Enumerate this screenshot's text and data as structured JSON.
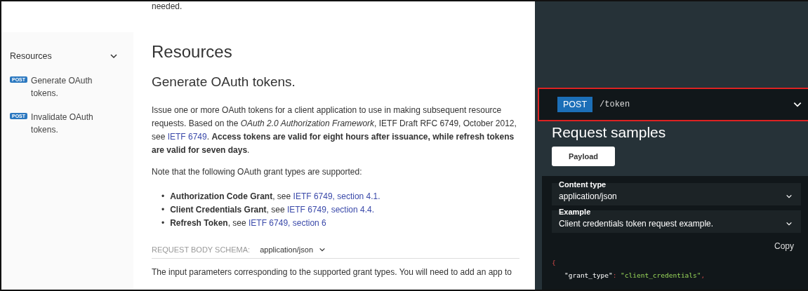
{
  "top_fragment": "needed.",
  "sidebar": {
    "section": {
      "label": "Resources",
      "expanded": true
    },
    "items": [
      {
        "method": "POST",
        "label": "Generate OAuth tokens."
      },
      {
        "method": "POST",
        "label": "Invalidate OAuth tokens."
      }
    ]
  },
  "content": {
    "title": "Resources",
    "subtitle": "Generate OAuth tokens.",
    "intro": [
      {
        "kind": "text",
        "text": "Issue one or more OAuth tokens for a client application to use in making subsequent resource requests. Based on the *OAuth 2.0 Authorization Framework*, IETF Draft RFC 6749, October 2012, see "
      },
      {
        "kind": "link",
        "text": "IETF 6749"
      },
      {
        "kind": "text",
        "text": ". **Access tokens are valid for eight hours after issuance, while refresh tokens are valid for seven days**."
      }
    ],
    "note": "Note that the following OAuth grant types are supported:",
    "grants": [
      {
        "bullet": "•",
        "term": "Authorization Code Grant",
        "see": ", see ",
        "link": "IETF 6749, section 4.1."
      },
      {
        "bullet": "•",
        "term": "Client Credentials Grant",
        "see": ", see ",
        "link": "IETF 6749, section 4.4."
      },
      {
        "bullet": "•",
        "term": "Refresh Token",
        "see": ", see ",
        "link": "IETF 6749, section 6"
      }
    ],
    "schema": {
      "label": "REQUEST BODY SCHEMA:",
      "value": "application/json"
    },
    "body_text": "The input parameters corresponding to the supported grant types. You will need to add an app to"
  },
  "panel": {
    "endpoint": {
      "method": "POST",
      "path": "/token",
      "highlighted": true
    },
    "title": "Request samples",
    "tab": "Payload",
    "selects": [
      {
        "label": "Content type",
        "value": "application/json"
      },
      {
        "label": "Example",
        "value": "Client credentials token request example."
      }
    ],
    "copy": "Copy",
    "code": [
      {
        "kind": "punct",
        "text": "{"
      },
      {
        "kind": "pair",
        "key": "\"grant_type\"",
        "sep": ":",
        "value": "\"client_credentials\"",
        "end": ","
      }
    ]
  }
}
